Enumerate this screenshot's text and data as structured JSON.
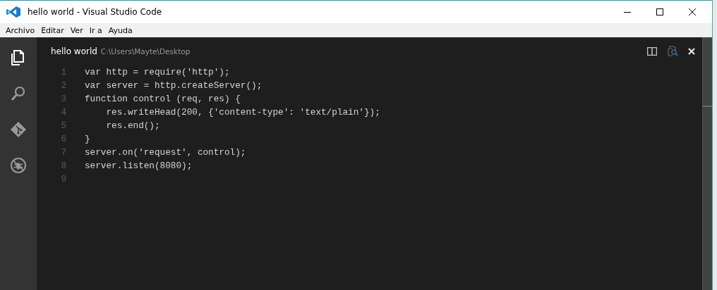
{
  "window": {
    "title": "hello world - Visual Studio Code"
  },
  "menu": [
    "Archivo",
    "Editar",
    "Ver",
    "Ir a",
    "Ayuda"
  ],
  "activity_bar": [
    {
      "kind": "files",
      "selected": true
    },
    {
      "kind": "search",
      "selected": false
    },
    {
      "kind": "git",
      "selected": false
    },
    {
      "kind": "debug",
      "selected": false
    }
  ],
  "editor": {
    "title": "hello world",
    "path": "C:\\Users\\Mayte\\Desktop",
    "lines": [
      {
        "number": "1",
        "text": "var http = require('http');"
      },
      {
        "number": "2",
        "text": "var server = http.createServer();"
      },
      {
        "number": "3",
        "text": "function control (req, res) {"
      },
      {
        "number": "4",
        "text": "    res.writeHead(200, {'content-type': 'text/plain'});"
      },
      {
        "number": "5",
        "text": "    res.end();"
      },
      {
        "number": "6",
        "text": "}"
      },
      {
        "number": "7",
        "text": "server.on('request', control);"
      },
      {
        "number": "8",
        "text": "server.listen(8080);"
      },
      {
        "number": "9"
      }
    ]
  }
}
